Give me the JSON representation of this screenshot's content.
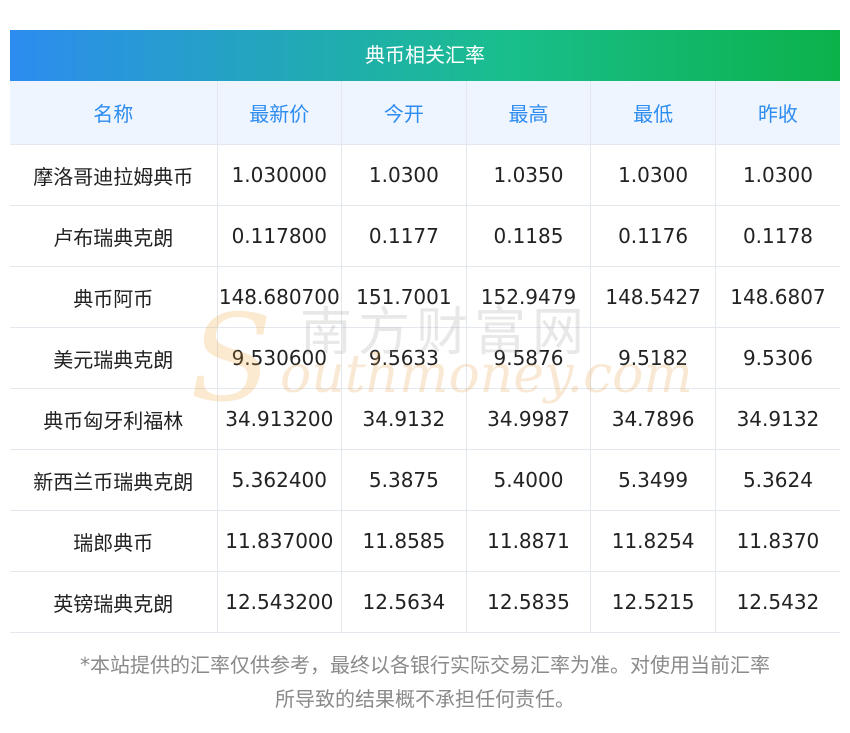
{
  "table": {
    "title": "典币相关汇率",
    "headers": [
      "名称",
      "最新价",
      "今开",
      "最高",
      "最低",
      "昨收"
    ],
    "rows": [
      [
        "摩洛哥迪拉姆典币",
        "1.030000",
        "1.0300",
        "1.0350",
        "1.0300",
        "1.0300"
      ],
      [
        "卢布瑞典克朗",
        "0.117800",
        "0.1177",
        "0.1185",
        "0.1176",
        "0.1178"
      ],
      [
        "典币阿币",
        "148.680700",
        "151.7001",
        "152.9479",
        "148.5427",
        "148.6807"
      ],
      [
        "美元瑞典克朗",
        "9.530600",
        "9.5633",
        "9.5876",
        "9.5182",
        "9.5306"
      ],
      [
        "典币匈牙利福林",
        "34.913200",
        "34.9132",
        "34.9987",
        "34.7896",
        "34.9132"
      ],
      [
        "新西兰币瑞典克朗",
        "5.362400",
        "5.3875",
        "5.4000",
        "5.3499",
        "5.3624"
      ],
      [
        "瑞郎典币",
        "11.837000",
        "11.8585",
        "11.8871",
        "11.8254",
        "11.8370"
      ],
      [
        "英镑瑞典克朗",
        "12.543200",
        "12.5634",
        "12.5835",
        "12.5215",
        "12.5432"
      ]
    ]
  },
  "watermark": {
    "cn": "南方财富网",
    "en": "outhmoney.com",
    "s": "S"
  },
  "note": {
    "line1": "*本站提供的汇率仅供参考，最终以各银行实际交易汇率为准。对使用当前汇率",
    "line2": "所导致的结果概不承担任何责任。"
  },
  "colors": {
    "header_text": "#2d8cf0",
    "header_bg": "#eff5ff",
    "title_gradient_start": "#2d8cf0",
    "title_gradient_end": "#0bb24a"
  }
}
